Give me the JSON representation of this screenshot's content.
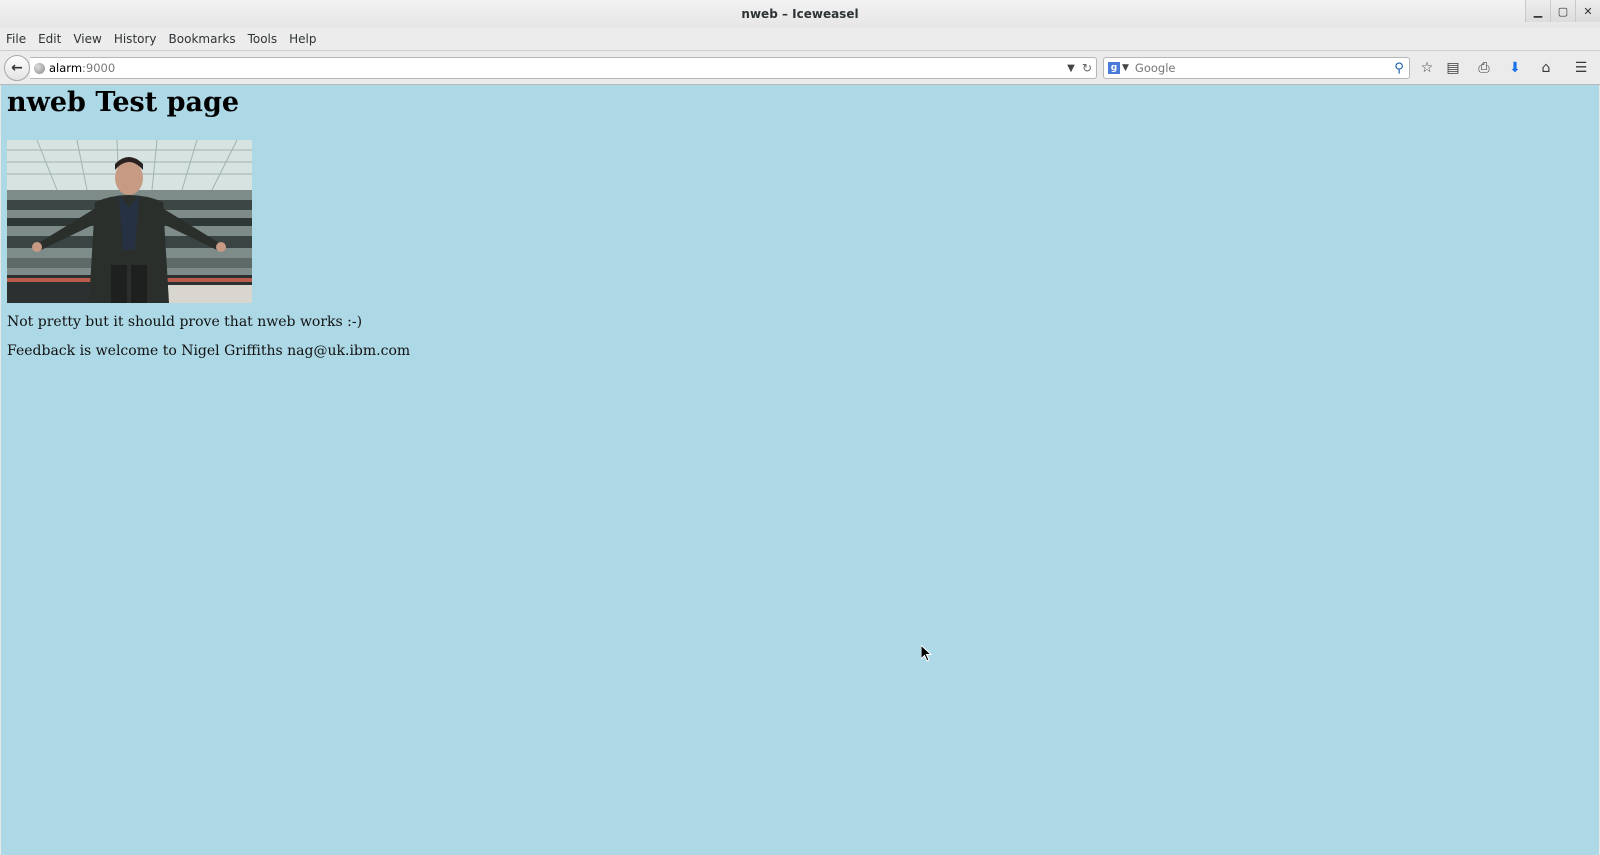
{
  "window": {
    "title": "nweb – Iceweasel"
  },
  "menu": [
    "File",
    "Edit",
    "View",
    "History",
    "Bookmarks",
    "Tools",
    "Help"
  ],
  "nav": {
    "url_host": "alarm",
    "url_port": ":9000",
    "search_placeholder": "Google"
  },
  "page": {
    "heading": "nweb Test page",
    "para1": "Not pretty but it should prove that nweb works :-)",
    "para2": "Feedback is welcome to Nigel Griffiths nag@uk.ibm.com"
  },
  "colors": {
    "page_background": "#add8e6"
  }
}
